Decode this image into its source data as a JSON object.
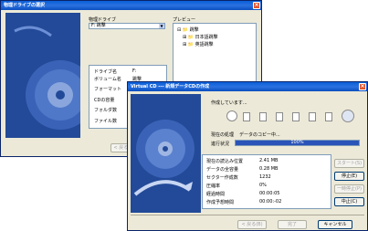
{
  "window1": {
    "title": "物理ドライブの選択",
    "drive_label": "物理ドライブ",
    "drive_value": "F: 跳撃",
    "preview_label": "プレビュー",
    "tree": [
      "跳撃",
      "日本語跳撃",
      "英語跳撃"
    ],
    "info_rows": [
      {
        "label": "ドライブ名",
        "value": "F:"
      },
      {
        "label": "ボリューム名",
        "value": "跳撃"
      },
      {
        "label": "フォーマット",
        "value": ""
      },
      {
        "label": "CDの容量",
        "value": ""
      },
      {
        "label": "フォルダ数",
        "value": ""
      },
      {
        "label": "ファイル数",
        "value": ""
      }
    ],
    "back_button": "< 戻る(B)"
  },
  "window2": {
    "title": "Virtual CD --- 新規データCDの作成",
    "creating_text": "作成しています...",
    "current_label": "現在の処理",
    "current_value": "データのコピー中...",
    "progress_label": "進行状況",
    "progress_percent": 100,
    "progress_text": "100%",
    "stats": [
      {
        "label": "現在の読込み位置",
        "value": "2.41 MB"
      },
      {
        "label": "データの全容量",
        "value": "0.28 MB"
      },
      {
        "label": "セクター作成数",
        "value": "1232"
      },
      {
        "label": "圧縮率",
        "value": "0%"
      },
      {
        "label": "経過時間",
        "value": "00:00:05"
      },
      {
        "label": "作成予想時間",
        "value": "00:00:-02"
      }
    ],
    "side_buttons": [
      "スタート(S)",
      "停止(E)",
      "一時停止(P)",
      "中止(C)"
    ],
    "back_button": "< 戻る(B)",
    "done_button": "完了",
    "cancel_button": "キャンセル"
  },
  "colors": {
    "title_blue": "#0a5fd8",
    "art_blue": "#234a98",
    "progress": "#2b54b8"
  }
}
